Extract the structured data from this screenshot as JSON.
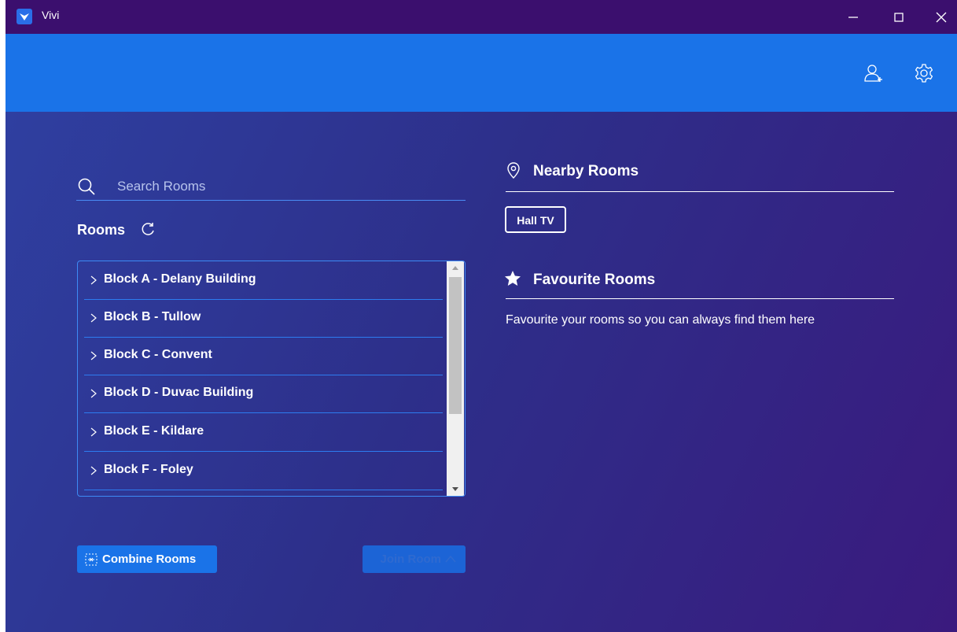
{
  "window": {
    "title": "Vivi"
  },
  "search": {
    "placeholder": "Search Rooms",
    "value": ""
  },
  "rooms": {
    "title": "Rooms",
    "items": [
      {
        "label": "Block A - Delany Building"
      },
      {
        "label": "Block B - Tullow"
      },
      {
        "label": "Block C - Convent"
      },
      {
        "label": "Block D - Duvac Building"
      },
      {
        "label": "Block E - Kildare"
      },
      {
        "label": "Block F - Foley"
      }
    ]
  },
  "actions": {
    "combine_label": "Combine Rooms",
    "join_label": "Join Room"
  },
  "nearby": {
    "title": "Nearby Rooms",
    "rooms": [
      "Hall TV"
    ]
  },
  "favourites": {
    "title": "Favourite Rooms",
    "empty_text": "Favourite your rooms so you can always find them here"
  },
  "colors": {
    "titlebar": "#3b0f6e",
    "header": "#1a73e8",
    "accent": "#1a73e8",
    "background_start": "#2f3fa0",
    "background_end": "#3a1a7e"
  },
  "icons": {
    "titlebar": [
      "vivi-logo-icon",
      "minimize-icon",
      "maximize-icon",
      "close-icon"
    ],
    "header": [
      "add-user-icon",
      "gear-icon"
    ],
    "content": [
      "search-icon",
      "refresh-icon",
      "chevron-right-icon",
      "combine-icon",
      "chevron-up-icon",
      "location-pin-icon",
      "star-icon"
    ]
  }
}
